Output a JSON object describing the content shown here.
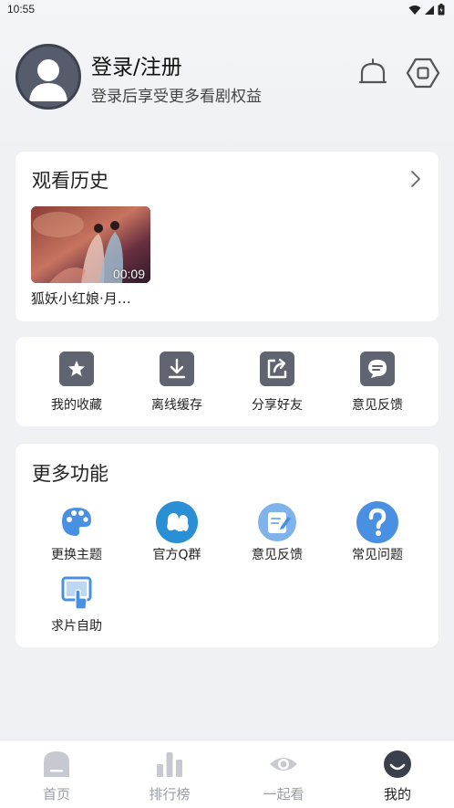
{
  "status_bar": {
    "time": "10:55"
  },
  "profile": {
    "title": "登录/注册",
    "subtitle": "登录后享受更多看剧权益"
  },
  "history": {
    "title": "观看历史",
    "items": [
      {
        "title": "狐妖小红娘·月…",
        "duration": "00:09"
      }
    ]
  },
  "quick_actions": [
    {
      "label": "我的收藏",
      "icon": "star-icon"
    },
    {
      "label": "离线缓存",
      "icon": "download-icon"
    },
    {
      "label": "分享好友",
      "icon": "share-icon"
    },
    {
      "label": "意见反馈",
      "icon": "chat-bubble-icon"
    }
  ],
  "more": {
    "title": "更多功能",
    "items": [
      {
        "label": "更换主题",
        "icon": "palette-icon"
      },
      {
        "label": "官方Q群",
        "icon": "qq-group-icon"
      },
      {
        "label": "意见反馈",
        "icon": "feedback-edit-icon"
      },
      {
        "label": "常见问题",
        "icon": "question-icon"
      },
      {
        "label": "求片自助",
        "icon": "touch-screen-icon"
      }
    ]
  },
  "bottom_nav": [
    {
      "label": "首页",
      "icon": "home-icon",
      "active": false
    },
    {
      "label": "排行榜",
      "icon": "ranking-icon",
      "active": false
    },
    {
      "label": "一起看",
      "icon": "eye-icon",
      "active": false
    },
    {
      "label": "我的",
      "icon": "profile-icon",
      "active": true
    }
  ],
  "colors": {
    "background": "#eff1f5",
    "card": "#ffffff",
    "accent_blue": "#4a90e2",
    "icon_gray": "#5f6470",
    "nav_inactive": "#9a9ea8"
  }
}
